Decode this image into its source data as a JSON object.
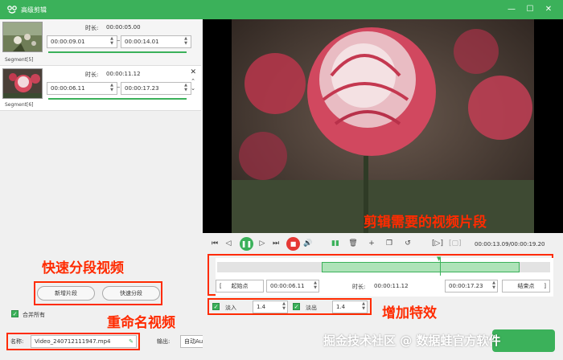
{
  "window": {
    "title": "高级剪辑",
    "minimize": "—",
    "maximize": "☐",
    "close": "✕"
  },
  "segments": [
    {
      "label": "Segment[5]",
      "duration_label": "时长:",
      "duration": "00:00:05.00",
      "start": "00:00:09.01",
      "end": "00:00:14.01"
    },
    {
      "label": "Segment[6]",
      "duration_label": "时长:",
      "duration": "00:00:11.12",
      "start": "00:00:06.11",
      "end": "00:00:17.23"
    }
  ],
  "buttons": {
    "add_segment": "新增片段",
    "quick_split": "快速分段"
  },
  "merge_all": "合并所有",
  "file": {
    "name_label": "名称:",
    "name_value": "Video_240712111947.mp4",
    "output_label": "输出:",
    "output_value": "自动Auto"
  },
  "annotations": {
    "quick_split": "快速分段视频",
    "rename": "重命名视频",
    "cut": "剪辑需要的视频片段",
    "effects": "增加特效"
  },
  "player": {
    "time_display": "00:00:13.09/00:00:19.20"
  },
  "timeline": {
    "start_btn": "起始点",
    "start_value": "00:00:06.11",
    "duration_label": "时长:",
    "duration_value": "00:00:11.12",
    "end_value": "00:00:17.23",
    "end_btn": "结束点"
  },
  "effects": {
    "fade_in_label": "淡入",
    "fade_in_value": "1.4",
    "fade_out_label": "淡出",
    "fade_out_value": "1.4"
  },
  "watermark": "掘金技术社区 @ 数据蛙官方软件",
  "colors": {
    "accent": "#3bb15a",
    "annotation": "#ff2b00"
  }
}
